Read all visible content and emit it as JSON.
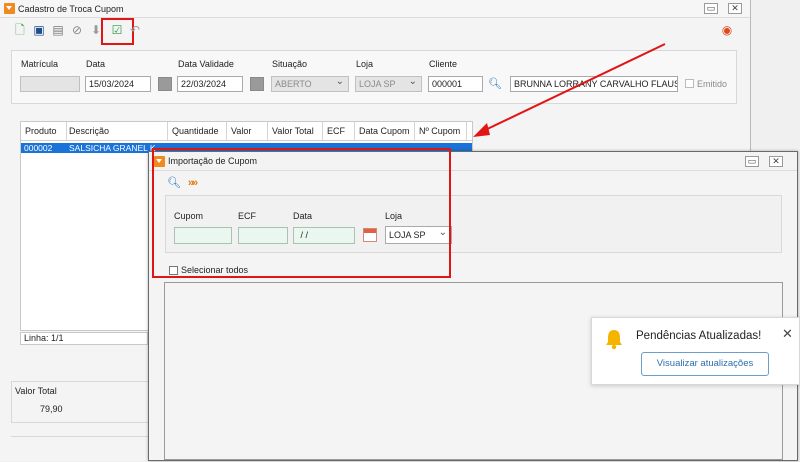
{
  "main_window": {
    "title": "Cadastro de Troca Cupom",
    "toolbar": {
      "icons": [
        "new-document-icon",
        "save-icon",
        "print-icon",
        "cancel-icon",
        "download-icon",
        "approve-import-icon",
        "undo-icon"
      ],
      "help_icon": "fire-icon"
    },
    "fields": {
      "matricula_label": "Matrícula",
      "matricula_value": "",
      "data_label": "Data",
      "data_value": "15/03/2024",
      "validade_label": "Data Validade",
      "validade_value": "22/03/2024",
      "situacao_label": "Situação",
      "situacao_value": "ABERTO",
      "loja_label": "Loja",
      "loja_value": "LOJA SP",
      "cliente_label": "Cliente",
      "cliente_code": "000001",
      "cliente_name": "BRUNNA LORRANY CARVALHO FLAUSINO",
      "emitido_label": "Emitido"
    },
    "grid": {
      "columns": [
        "Produto",
        "Descrição",
        "Quantidade",
        "Valor",
        "Valor Total",
        "ECF",
        "Data Cupom",
        "Nº Cupom"
      ],
      "rows": [
        {
          "produto": "000002",
          "descricao": "SALSICHA GRANEL K"
        }
      ]
    },
    "line_status": "Linha: 1/1",
    "valor_total_label": "Valor Total",
    "valor_total_value": "79,90"
  },
  "dialog": {
    "title": "Importação de Cupom",
    "icons": [
      "search-document-icon",
      "forward-arrows-icon"
    ],
    "cupom_label": "Cupom",
    "cupom_value": "",
    "ecf_label": "ECF",
    "ecf_value": "",
    "data_label": "Data",
    "data_value": " / /",
    "loja_label": "Loja",
    "loja_value": "LOJA SP",
    "select_all_label": "Selecionar todos"
  },
  "notification": {
    "icon": "bell-icon",
    "title": "Pendências Atualizadas!",
    "button_label": "Visualizar atualizações"
  },
  "colors": {
    "accent_orange": "#f08a1e",
    "selection_blue": "#1a73d8",
    "annotation_red": "#e01515",
    "dialog_field_bg": "#e9f7ef",
    "bell_yellow": "#f5b400"
  }
}
